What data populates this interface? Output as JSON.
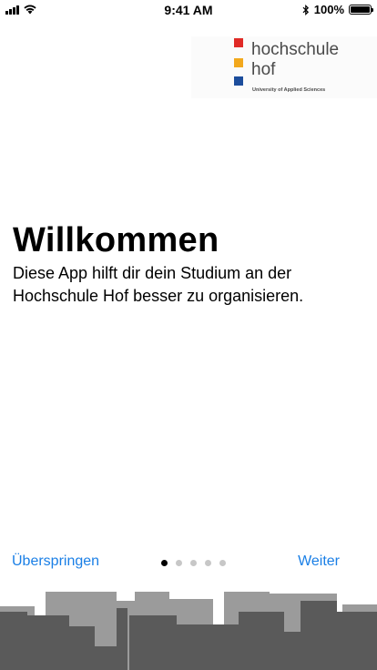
{
  "status_bar": {
    "time": "9:41 AM",
    "battery_percent": "100%",
    "signal_level": 4,
    "wifi": true,
    "bluetooth": true,
    "icons": [
      "signal-icon",
      "wifi-icon",
      "bluetooth-icon",
      "battery-icon"
    ]
  },
  "logo": {
    "name": "hochschule\nhof",
    "subtitle": "University of Applied Sciences",
    "mark_colors": [
      "#e02a26",
      "#f2a81d",
      "#1c4d9c"
    ]
  },
  "welcome": {
    "title": "Willkommen",
    "text": "Diese App hilft dir dein Studium an der Hochschule Hof besser zu organisieren."
  },
  "navigation": {
    "skip_label": "Überspringen",
    "next_label": "Weiter",
    "page_count": 5,
    "current_page": 1
  },
  "colors": {
    "accent": "#1a7fe6",
    "skyline_dark": "#5a5a5a",
    "skyline_light": "#9b9b9b"
  }
}
